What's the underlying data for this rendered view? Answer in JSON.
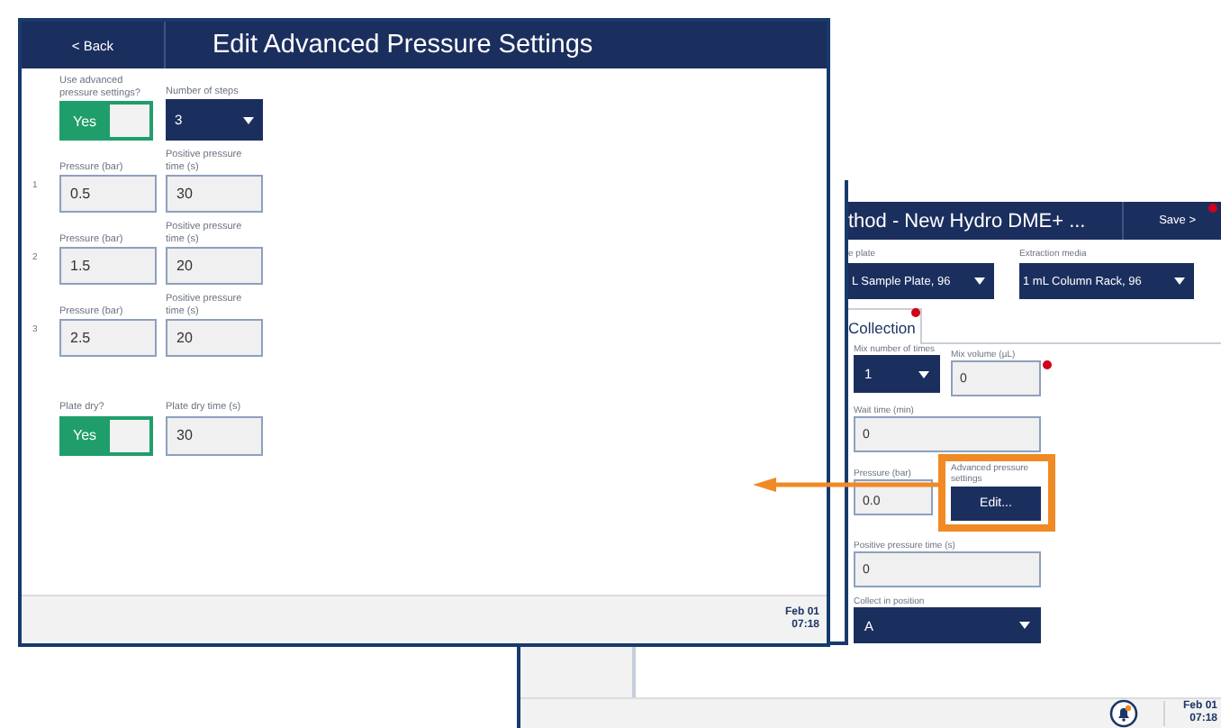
{
  "front_window": {
    "back_button": "< Back",
    "title": "Edit Advanced Pressure Settings",
    "use_advanced": {
      "label": "Use advanced pressure settings?",
      "toggle": {
        "label": "Yes",
        "on": true
      }
    },
    "steps": {
      "label": "Number of steps",
      "value": "3"
    },
    "pressure_steps": [
      {
        "number": "1",
        "pressure_label": "Pressure (bar)",
        "pressure": "0.5",
        "time_label": "Positive pressure time (s)",
        "time": "30"
      },
      {
        "number": "2",
        "pressure_label": "Pressure (bar)",
        "pressure": "1.5",
        "time_label": "Positive pressure time (s)",
        "time": "20"
      },
      {
        "number": "3",
        "pressure_label": "Pressure (bar)",
        "pressure": "2.5",
        "time_label": "Positive pressure time (s)",
        "time": "20"
      }
    ],
    "plate_dry": {
      "label": "Plate dry?",
      "toggle": {
        "label": "Yes",
        "on": true
      }
    },
    "plate_dry_time": {
      "label": "Plate dry time (s)",
      "value": "30"
    },
    "status_bar": {
      "date": "Feb 01",
      "time": "07:18"
    }
  },
  "back_window": {
    "title": "thod - New Hydro DME+ ...",
    "save_button": {
      "label": "Save >",
      "alert": true
    },
    "plates": [
      {
        "label": "e plate",
        "value": "L Sample Plate, 96"
      },
      {
        "label": "Extraction media",
        "value": "1 mL Column Rack, 96"
      }
    ],
    "tab": {
      "label": "Collection",
      "alert": true
    },
    "mix_times": {
      "label": "Mix number of times",
      "value": "1"
    },
    "mix_volume": {
      "label": "Mix volume (µL)",
      "value": "0",
      "alert": true
    },
    "wait_time": {
      "label": "Wait time (min)",
      "value": "0"
    },
    "pressure": {
      "label": "Pressure (bar)",
      "value": "0.0"
    },
    "advanced": {
      "label": "Advanced pressure settings",
      "button": "Edit..."
    },
    "positive_time": {
      "label": "Positive pressure time (s)",
      "value": "0"
    },
    "collect_position": {
      "label": "Collect in position",
      "value": "A"
    },
    "status_bar": {
      "date": "Feb 01",
      "time": "07:18"
    }
  }
}
